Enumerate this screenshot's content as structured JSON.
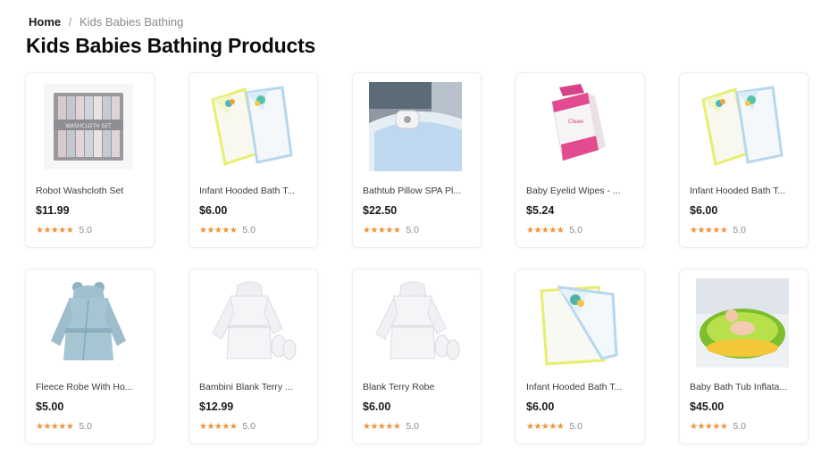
{
  "breadcrumb": {
    "home": "Home",
    "separator": "/",
    "current": "Kids Babies Bathing"
  },
  "title": "Kids Babies Bathing Products",
  "colors": {
    "star": "#f0933a",
    "title": "#0d0d0d"
  },
  "products": [
    {
      "name": "Robot Washcloth Set",
      "price": "$11.99",
      "stars": "★★★★★",
      "rating": "5.0",
      "image": "washcloth-set-box"
    },
    {
      "name": "Infant Hooded Bath T...",
      "price": "$6.00",
      "stars": "★★★★★",
      "rating": "5.0",
      "image": "hooded-towels"
    },
    {
      "name": "Bathtub Pillow SPA Pl...",
      "price": "$22.50",
      "stars": "★★★★★",
      "rating": "5.0",
      "image": "bathtub-pillow"
    },
    {
      "name": "Baby Eyelid Wipes - ...",
      "price": "$5.24",
      "stars": "★★★★★",
      "rating": "5.0",
      "image": "eyelid-wipes-box"
    },
    {
      "name": "Infant Hooded Bath T...",
      "price": "$6.00",
      "stars": "★★★★★",
      "rating": "5.0",
      "image": "hooded-towels"
    },
    {
      "name": "Fleece Robe With Ho...",
      "price": "$5.00",
      "stars": "★★★★★",
      "rating": "5.0",
      "image": "fleece-robe"
    },
    {
      "name": "Bambini Blank Terry ...",
      "price": "$12.99",
      "stars": "★★★★★",
      "rating": "5.0",
      "image": "terry-robe-slippers"
    },
    {
      "name": "Blank Terry Robe",
      "price": "$6.00",
      "stars": "★★★★★",
      "rating": "5.0",
      "image": "terry-robe-slippers"
    },
    {
      "name": "Infant Hooded Bath T...",
      "price": "$6.00",
      "stars": "★★★★★",
      "rating": "5.0",
      "image": "folded-hooded-towel"
    },
    {
      "name": "Baby Bath Tub Inflata...",
      "price": "$45.00",
      "stars": "★★★★★",
      "rating": "5.0",
      "image": "inflatable-tub"
    }
  ]
}
